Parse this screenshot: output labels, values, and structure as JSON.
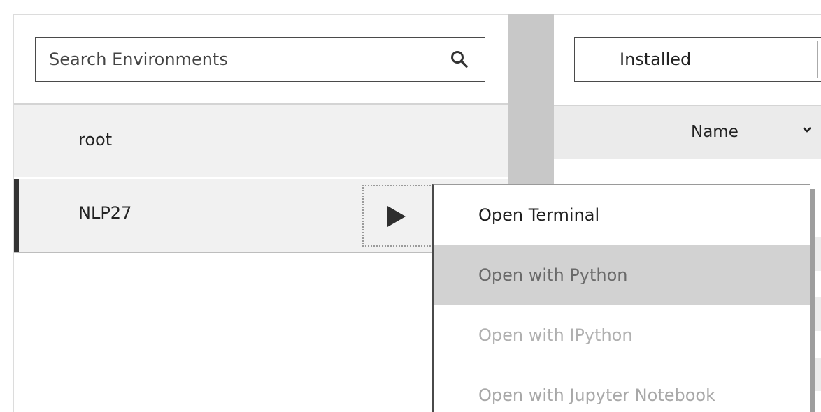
{
  "environments": {
    "search": {
      "placeholder": "Search Environments",
      "icon": "search-icon"
    },
    "items": [
      {
        "name": "root",
        "selected": false
      },
      {
        "name": "NLP27",
        "selected": true,
        "action_icon": "play-icon"
      }
    ]
  },
  "packages": {
    "filter": {
      "selected": "Installed"
    },
    "columns": [
      {
        "label": "Name",
        "icon": "chevron-down-icon"
      }
    ]
  },
  "context_menu": {
    "items": [
      {
        "label": "Open Terminal",
        "state": "enabled"
      },
      {
        "label": "Open with Python",
        "state": "hovered"
      },
      {
        "label": "Open with IPython",
        "state": "disabled"
      },
      {
        "label": "Open with Jupyter Notebook",
        "state": "disabled"
      }
    ]
  },
  "colors": {
    "selected_indicator": "#333333",
    "row_background": "#f1f1f1",
    "divider": "#c8c8c8",
    "menu_hover": "#d2d2d2",
    "disabled_text": "#b0b0b0"
  }
}
